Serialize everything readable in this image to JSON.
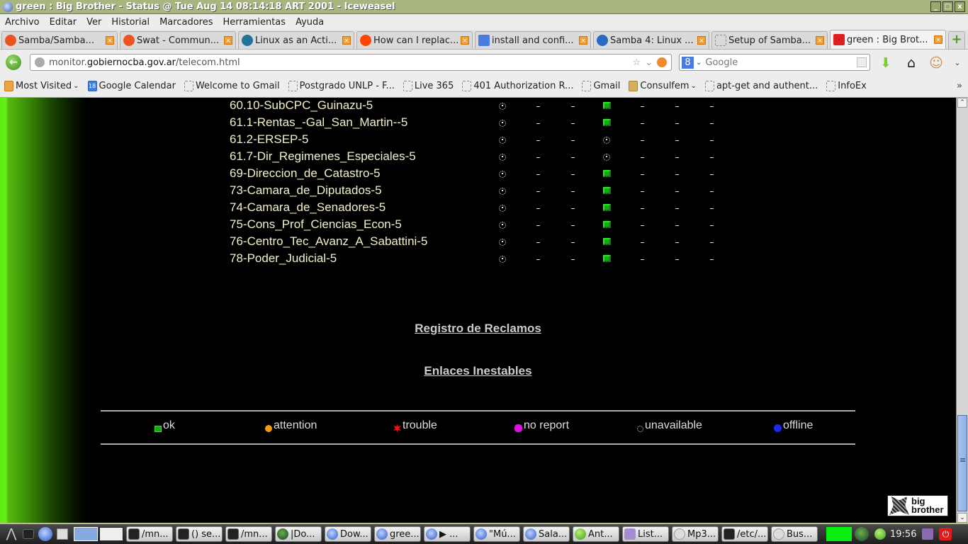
{
  "window": {
    "title": "green : Big Brother - Status @ Tue Aug 14 08:14:18 ART 2001 - Iceweasel",
    "controls": [
      "_",
      "□",
      "x"
    ]
  },
  "menubar": [
    "Archivo",
    "Editar",
    "Ver",
    "Historial",
    "Marcadores",
    "Herramientas",
    "Ayuda"
  ],
  "tabs": [
    {
      "label": "Samba/Samba...",
      "icon": "ubuntu-icon",
      "color": "#e95420",
      "active": false
    },
    {
      "label": "Swat - Commun...",
      "icon": "ubuntu-icon",
      "color": "#e95420",
      "active": false
    },
    {
      "label": "Linux as an Acti...",
      "icon": "wordpress-icon",
      "color": "#21759b",
      "active": false
    },
    {
      "label": "How can I replac...",
      "icon": "reddit-icon",
      "color": "#ff4500",
      "active": false
    },
    {
      "label": "install and confi...",
      "icon": "google-icon",
      "color": "#4a7be0",
      "active": false
    },
    {
      "label": "Samba 4: Linux ...",
      "icon": "samba-icon",
      "color": "#2a6ac0",
      "active": false
    },
    {
      "label": "Setup of Samba...",
      "icon": "blank-page-icon",
      "color": "#ffffff",
      "active": false
    },
    {
      "label": "green : Big Brot...",
      "icon": "bigbrother-icon",
      "color": "#e02020",
      "active": true
    }
  ],
  "navbar": {
    "url_prefix": "monitor.",
    "url_domain": "gobiernocba.gov.ar",
    "url_path": "/telecom.html",
    "search_placeholder": "Google"
  },
  "bookmarks": [
    {
      "label": "Most Visited",
      "icon": "folder",
      "dropdown": true
    },
    {
      "label": "Google Calendar",
      "icon": "cal",
      "dropdown": false
    },
    {
      "label": "Welcome to Gmail",
      "icon": "blank",
      "dropdown": false
    },
    {
      "label": "Postgrado UNLP - F...",
      "icon": "blank",
      "dropdown": false
    },
    {
      "label": "Live 365",
      "icon": "blank",
      "dropdown": false
    },
    {
      "label": "401 Authorization R...",
      "icon": "blank",
      "dropdown": false
    },
    {
      "label": "Gmail",
      "icon": "blank",
      "dropdown": false
    },
    {
      "label": "Consulfem",
      "icon": "fold2",
      "dropdown": true
    },
    {
      "label": "apt-get and authent...",
      "icon": "blank",
      "dropdown": false
    },
    {
      "label": "InfoEx",
      "icon": "blank",
      "dropdown": false
    }
  ],
  "bookmarks_more": "»",
  "status": {
    "rows": [
      {
        "name": "60.10-SubCPC_Guinazu-5",
        "cells": [
          "unavailable",
          "-",
          "-",
          "ok",
          "-",
          "-",
          "-"
        ]
      },
      {
        "name": "61.1-Rentas_-Gal_San_Martin--5",
        "cells": [
          "unavailable",
          "-",
          "-",
          "ok",
          "-",
          "-",
          "-"
        ]
      },
      {
        "name": "61.2-ERSEP-5",
        "cells": [
          "unavailable",
          "-",
          "-",
          "unavailable",
          "-",
          "-",
          "-"
        ]
      },
      {
        "name": "61.7-Dir_Regimenes_Especiales-5",
        "cells": [
          "unavailable",
          "-",
          "-",
          "unavailable",
          "-",
          "-",
          "-"
        ]
      },
      {
        "name": "69-Direccion_de_Catastro-5",
        "cells": [
          "unavailable",
          "-",
          "-",
          "ok",
          "-",
          "-",
          "-"
        ]
      },
      {
        "name": "73-Camara_de_Diputados-5",
        "cells": [
          "unavailable",
          "-",
          "-",
          "ok",
          "-",
          "-",
          "-"
        ]
      },
      {
        "name": "74-Camara_de_Senadores-5",
        "cells": [
          "unavailable",
          "-",
          "-",
          "ok",
          "-",
          "-",
          "-"
        ]
      },
      {
        "name": "75-Cons_Prof_Ciencias_Econ-5",
        "cells": [
          "unavailable",
          "-",
          "-",
          "ok",
          "-",
          "-",
          "-"
        ]
      },
      {
        "name": "76-Centro_Tec_Avanz_A_Sabattini-5",
        "cells": [
          "unavailable",
          "-",
          "-",
          "ok",
          "-",
          "-",
          "-"
        ]
      },
      {
        "name": "78-Poder_Judicial-5",
        "cells": [
          "unavailable",
          "-",
          "-",
          "ok",
          "-",
          "-",
          "-"
        ]
      }
    ]
  },
  "links": {
    "registro": "Registro de Reclamos",
    "enlaces": "Enlaces Inestables"
  },
  "legend": [
    {
      "key": "ok",
      "label": "ok",
      "color": "#22ee22"
    },
    {
      "key": "attn",
      "label": "attention",
      "color": "#f79a10"
    },
    {
      "key": "trouble",
      "label": "trouble",
      "color": "#ee1111"
    },
    {
      "key": "norep",
      "label": "no report",
      "color": "#e010e0"
    },
    {
      "key": "unavail",
      "label": "unavailable",
      "color": "#dddddd"
    },
    {
      "key": "off",
      "label": "offline",
      "color": "#1a2aee"
    }
  ],
  "bb_logo": {
    "line1": "big",
    "line2": "brother"
  },
  "taskbar": {
    "tasks": [
      {
        "label": "/mn...",
        "icon": "term"
      },
      {
        "label": "() se...",
        "icon": "term"
      },
      {
        "label": "/mn...",
        "icon": "term"
      },
      {
        "label": "|Do...",
        "icon": "globe"
      },
      {
        "label": "Dow...",
        "icon": "ff"
      },
      {
        "label": "gree...",
        "icon": "ff"
      },
      {
        "label": "▶ ...",
        "icon": "ff"
      },
      {
        "label": "\"Mú...",
        "icon": "ff"
      },
      {
        "label": "Sala...",
        "icon": "ff"
      },
      {
        "label": "Ant...",
        "icon": "green"
      },
      {
        "label": "List...",
        "icon": "pidgin"
      },
      {
        "label": "Mp3...",
        "icon": "search"
      },
      {
        "label": "/etc/...",
        "icon": "term"
      },
      {
        "label": "Bus...",
        "icon": "search"
      }
    ],
    "clock": "19:56"
  }
}
